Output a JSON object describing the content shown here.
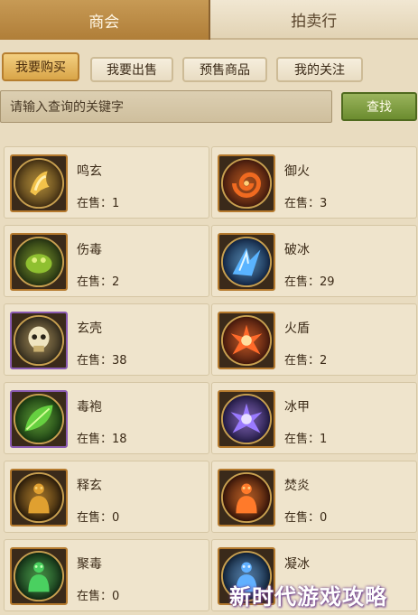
{
  "top_tabs": [
    {
      "label": "商会",
      "active": true
    },
    {
      "label": "拍卖行",
      "active": false
    }
  ],
  "sub_tabs": [
    {
      "label": "我要购买",
      "active": true
    },
    {
      "label": "我要出售",
      "active": false
    },
    {
      "label": "预售商品",
      "active": false
    },
    {
      "label": "我的关注",
      "active": false
    }
  ],
  "search": {
    "placeholder": "请输入查询的关键字",
    "button_label": "查找"
  },
  "stock_prefix": "在售：",
  "items": [
    {
      "name": "鸣玄",
      "stock": "1",
      "icon": "golden-claw-icon",
      "frame": "orange"
    },
    {
      "name": "御火",
      "stock": "3",
      "icon": "fire-swirl-icon",
      "frame": "orange"
    },
    {
      "name": "伤毒",
      "stock": "2",
      "icon": "poison-creature-icon",
      "frame": "orange"
    },
    {
      "name": "破冰",
      "stock": "29",
      "icon": "ice-shard-icon",
      "frame": "orange"
    },
    {
      "name": "玄壳",
      "stock": "38",
      "icon": "skull-shell-icon",
      "frame": "purple"
    },
    {
      "name": "火盾",
      "stock": "2",
      "icon": "fire-shield-icon",
      "frame": "orange"
    },
    {
      "name": "毒袍",
      "stock": "18",
      "icon": "poison-robe-icon",
      "frame": "purple"
    },
    {
      "name": "冰甲",
      "stock": "1",
      "icon": "ice-armor-icon",
      "frame": "orange"
    },
    {
      "name": "释玄",
      "stock": "0",
      "icon": "dark-figure-icon",
      "frame": "orange"
    },
    {
      "name": "焚炎",
      "stock": "0",
      "icon": "flame-figure-icon",
      "frame": "orange"
    },
    {
      "name": "聚毒",
      "stock": "0",
      "icon": "poison-figure-icon",
      "frame": "orange"
    },
    {
      "name": "凝冰",
      "stock": "",
      "icon": "ice-figure-icon",
      "frame": "orange"
    }
  ],
  "watermark": "新时代游戏攻略",
  "colors": {
    "active_tab": "#b07e38",
    "search_button": "#6b8c2f",
    "orange_frame": "#b57a2e",
    "purple_frame": "#8a5ab0"
  }
}
